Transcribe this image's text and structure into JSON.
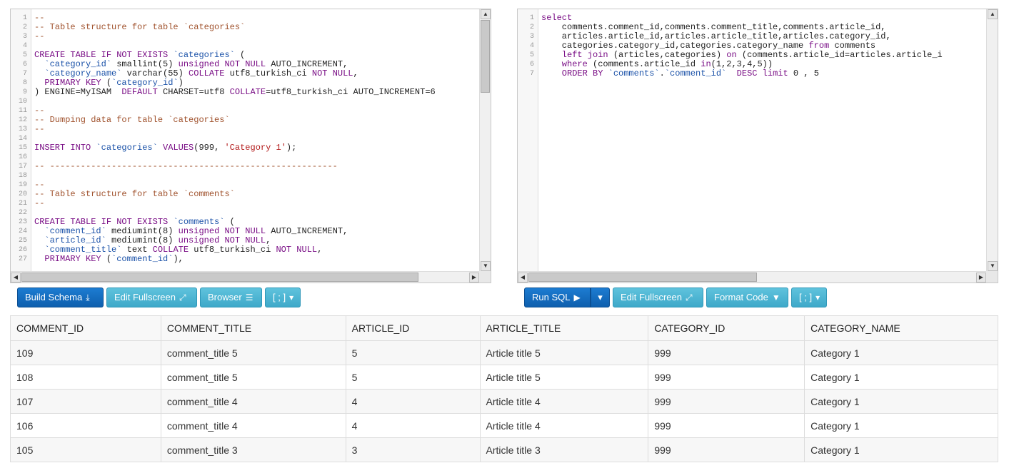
{
  "left_editor": {
    "lines": [
      [
        {
          "t": "--",
          "c": "c-comment"
        }
      ],
      [
        {
          "t": "-- Table structure for table `categories`",
          "c": "c-comment"
        }
      ],
      [
        {
          "t": "--",
          "c": "c-comment"
        }
      ],
      [],
      [
        {
          "t": "CREATE TABLE IF NOT EXISTS ",
          "c": "c-kw"
        },
        {
          "t": "`categories`",
          "c": "c-ident"
        },
        {
          "t": " (",
          "c": "c-plain"
        }
      ],
      [
        {
          "t": "  `category_id`",
          "c": "c-ident"
        },
        {
          "t": " smallint(5) ",
          "c": "c-plain"
        },
        {
          "t": "unsigned NOT NULL",
          "c": "c-kw"
        },
        {
          "t": " AUTO_INCREMENT,",
          "c": "c-plain"
        }
      ],
      [
        {
          "t": "  `category_name`",
          "c": "c-ident"
        },
        {
          "t": " varchar(55) ",
          "c": "c-plain"
        },
        {
          "t": "COLLATE",
          "c": "c-kw"
        },
        {
          "t": " utf8_turkish_ci ",
          "c": "c-plain"
        },
        {
          "t": "NOT NULL",
          "c": "c-kw"
        },
        {
          "t": ",",
          "c": "c-plain"
        }
      ],
      [
        {
          "t": "  PRIMARY KEY",
          "c": "c-kw"
        },
        {
          "t": " (",
          "c": "c-plain"
        },
        {
          "t": "`category_id`",
          "c": "c-ident"
        },
        {
          "t": ")",
          "c": "c-plain"
        }
      ],
      [
        {
          "t": ") ENGINE=MyISAM  ",
          "c": "c-plain"
        },
        {
          "t": "DEFAULT",
          "c": "c-kw"
        },
        {
          "t": " CHARSET=utf8 ",
          "c": "c-plain"
        },
        {
          "t": "COLLATE",
          "c": "c-kw"
        },
        {
          "t": "=utf8_turkish_ci AUTO_INCREMENT=6",
          "c": "c-plain"
        }
      ],
      [],
      [
        {
          "t": "--",
          "c": "c-comment"
        }
      ],
      [
        {
          "t": "-- Dumping data for table `categories`",
          "c": "c-comment"
        }
      ],
      [
        {
          "t": "--",
          "c": "c-comment"
        }
      ],
      [],
      [
        {
          "t": "INSERT INTO ",
          "c": "c-kw"
        },
        {
          "t": "`categories`",
          "c": "c-ident"
        },
        {
          "t": " ",
          "c": "c-plain"
        },
        {
          "t": "VALUES",
          "c": "c-kw"
        },
        {
          "t": "(999, ",
          "c": "c-plain"
        },
        {
          "t": "'Category 1'",
          "c": "c-str"
        },
        {
          "t": ");",
          "c": "c-plain"
        }
      ],
      [],
      [
        {
          "t": "-- --------------------------------------------------------",
          "c": "c-comment"
        }
      ],
      [],
      [
        {
          "t": "--",
          "c": "c-comment"
        }
      ],
      [
        {
          "t": "-- Table structure for table `comments`",
          "c": "c-comment"
        }
      ],
      [
        {
          "t": "--",
          "c": "c-comment"
        }
      ],
      [],
      [
        {
          "t": "CREATE TABLE IF NOT EXISTS ",
          "c": "c-kw"
        },
        {
          "t": "`comments`",
          "c": "c-ident"
        },
        {
          "t": " (",
          "c": "c-plain"
        }
      ],
      [
        {
          "t": "  `comment_id`",
          "c": "c-ident"
        },
        {
          "t": " mediumint(8) ",
          "c": "c-plain"
        },
        {
          "t": "unsigned NOT NULL",
          "c": "c-kw"
        },
        {
          "t": " AUTO_INCREMENT,",
          "c": "c-plain"
        }
      ],
      [
        {
          "t": "  `article_id`",
          "c": "c-ident"
        },
        {
          "t": " mediumint(8) ",
          "c": "c-plain"
        },
        {
          "t": "unsigned NOT NULL",
          "c": "c-kw"
        },
        {
          "t": ",",
          "c": "c-plain"
        }
      ],
      [
        {
          "t": "  `comment_title`",
          "c": "c-ident"
        },
        {
          "t": " text ",
          "c": "c-plain"
        },
        {
          "t": "COLLATE",
          "c": "c-kw"
        },
        {
          "t": " utf8_turkish_ci ",
          "c": "c-plain"
        },
        {
          "t": "NOT NULL",
          "c": "c-kw"
        },
        {
          "t": ",",
          "c": "c-plain"
        }
      ],
      [
        {
          "t": "  PRIMARY KEY",
          "c": "c-kw"
        },
        {
          "t": " (",
          "c": "c-plain"
        },
        {
          "t": "`comment_id`",
          "c": "c-ident"
        },
        {
          "t": "),",
          "c": "c-plain"
        }
      ]
    ]
  },
  "right_editor": {
    "lines": [
      [
        {
          "t": "select",
          "c": "c-kw"
        }
      ],
      [
        {
          "t": "    comments.comment_id,comments.comment_title,comments.article_id,",
          "c": "c-plain"
        }
      ],
      [
        {
          "t": "    articles.article_id,articles.article_title,articles.category_id,",
          "c": "c-plain"
        }
      ],
      [
        {
          "t": "    categories.category_id,categories.category_name ",
          "c": "c-plain"
        },
        {
          "t": "from",
          "c": "c-kw"
        },
        {
          "t": " comments",
          "c": "c-plain"
        }
      ],
      [
        {
          "t": "    left join",
          "c": "c-kw"
        },
        {
          "t": " (articles,categories) ",
          "c": "c-plain"
        },
        {
          "t": "on",
          "c": "c-kw"
        },
        {
          "t": " (comments.article_id=articles.article_i",
          "c": "c-plain"
        }
      ],
      [
        {
          "t": "    where",
          "c": "c-kw"
        },
        {
          "t": " (comments.article_id ",
          "c": "c-plain"
        },
        {
          "t": "in",
          "c": "c-kw"
        },
        {
          "t": "(1,2,3,4,5))",
          "c": "c-plain"
        }
      ],
      [
        {
          "t": "    ORDER BY ",
          "c": "c-kw"
        },
        {
          "t": "`comments`",
          "c": "c-ident"
        },
        {
          "t": ".",
          "c": "c-plain"
        },
        {
          "t": "`comment_id`",
          "c": "c-ident"
        },
        {
          "t": "  ",
          "c": "c-plain"
        },
        {
          "t": "DESC limit",
          "c": "c-kw"
        },
        {
          "t": " 0 , 5",
          "c": "c-plain"
        }
      ]
    ]
  },
  "toolbar_left": {
    "build_schema": "Build Schema",
    "edit_fullscreen": "Edit Fullscreen",
    "browser": "Browser",
    "delimiter": "[ ; ]"
  },
  "toolbar_right": {
    "run_sql": "Run SQL",
    "edit_fullscreen": "Edit Fullscreen",
    "format_code": "Format Code",
    "delimiter": "[ ; ]"
  },
  "results": {
    "columns": [
      "COMMENT_ID",
      "COMMENT_TITLE",
      "ARTICLE_ID",
      "ARTICLE_TITLE",
      "CATEGORY_ID",
      "CATEGORY_NAME"
    ],
    "rows": [
      [
        "109",
        "comment_title 5",
        "5",
        "Article title 5",
        "999",
        "Category 1"
      ],
      [
        "108",
        "comment_title 5",
        "5",
        "Article title 5",
        "999",
        "Category 1"
      ],
      [
        "107",
        "comment_title 4",
        "4",
        "Article title 4",
        "999",
        "Category 1"
      ],
      [
        "106",
        "comment_title 4",
        "4",
        "Article title 4",
        "999",
        "Category 1"
      ],
      [
        "105",
        "comment_title 3",
        "3",
        "Article title 3",
        "999",
        "Category 1"
      ]
    ]
  }
}
